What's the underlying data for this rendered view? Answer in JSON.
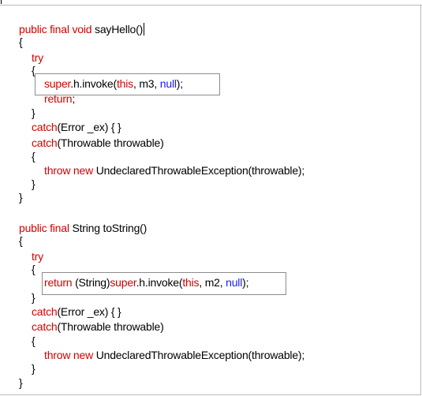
{
  "m1": {
    "sig_kw": "public final void ",
    "sig_name": "sayHello()",
    "open": "{",
    "try": "try",
    "try_open": "{",
    "inv_super": "super",
    "inv_mid": ".h.invoke(",
    "inv_this": "this",
    "inv_args": ", m3, ",
    "inv_null": "null",
    "inv_end": ");",
    "ret_kw": "return",
    "ret_end": ";",
    "try_close": "}",
    "c1_kw": "catch",
    "c1_rest": "(Error _ex) { }",
    "c2_kw": "catch",
    "c2_rest": "(Throwable throwable)",
    "c2_open": "{",
    "throw_kw": "throw new ",
    "throw_rest": "UndeclaredThrowableException(throwable);",
    "c2_close": "}",
    "close": "}"
  },
  "m2": {
    "sig_kw": "public final ",
    "sig_name": "String toString()",
    "open": "{",
    "try": "try",
    "try_open": "{",
    "ret_kw": "return ",
    "ret_cast": "(String)",
    "inv_super": "super",
    "inv_mid": ".h.invoke(",
    "inv_this": "this",
    "inv_args": ", m2, ",
    "inv_null": "null",
    "inv_end": ");",
    "try_close": "}",
    "c1_kw": "catch",
    "c1_rest": "(Error _ex) { }",
    "c2_kw": "catch",
    "c2_rest": "(Throwable throwable)",
    "c2_open": "{",
    "throw_kw": "throw new ",
    "throw_rest": "UndeclaredThrowableException(throwable);",
    "c2_close": "}",
    "close": "}"
  },
  "colors": {
    "keyword": "#d40000",
    "literal": "#1a1aff",
    "highlight_border": "#8c8c8c"
  }
}
